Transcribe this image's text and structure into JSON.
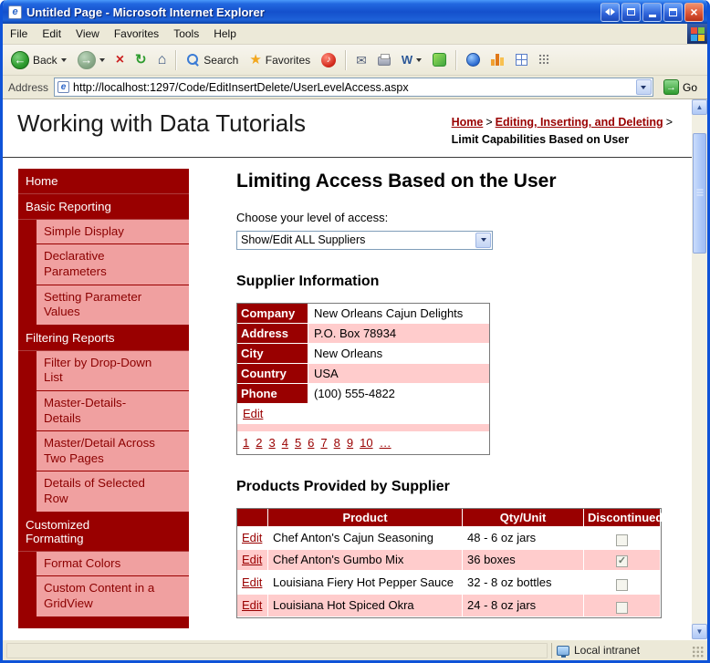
{
  "window": {
    "title": "Untitled Page - Microsoft Internet Explorer",
    "status_zone_label": "Local intranet"
  },
  "menu": {
    "items": [
      "File",
      "Edit",
      "View",
      "Favorites",
      "Tools",
      "Help"
    ]
  },
  "toolbar": {
    "back_label": "Back",
    "search_label": "Search",
    "favorites_label": "Favorites"
  },
  "address": {
    "label": "Address",
    "url": "http://localhost:1297/Code/EditInsertDelete/UserLevelAccess.aspx",
    "go_label": "Go"
  },
  "icons": {
    "ie_e": "e",
    "close": "×",
    "back_arrow": "←",
    "forward_arrow": "→",
    "stop": "×",
    "refresh": "↻",
    "home": "⌂",
    "favorites_star": "★",
    "media_note": "♪",
    "mail": "✉",
    "edit_w": "W",
    "go_arrow": "→",
    "arrow_up": "▲",
    "arrow_down": "▼"
  },
  "header": {
    "site_title": "Working with Data Tutorials",
    "breadcrumb": {
      "home": "Home",
      "separator": ">",
      "section": "Editing, Inserting, and Deleting",
      "current": "Limit Capabilities Based on User"
    }
  },
  "sidebar": {
    "items": [
      {
        "label": "Home",
        "type": "parent"
      },
      {
        "label": "Basic Reporting",
        "type": "parent"
      },
      {
        "label": "Simple Display",
        "type": "child"
      },
      {
        "label": "Declarative Parameters",
        "type": "child"
      },
      {
        "label": "Setting Parameter Values",
        "type": "child"
      },
      {
        "label": "Filtering Reports",
        "type": "parent"
      },
      {
        "label": "Filter by Drop-Down List",
        "type": "child"
      },
      {
        "label": "Master-Details-Details",
        "type": "child"
      },
      {
        "label": "Master/Detail Across Two Pages",
        "type": "child"
      },
      {
        "label": "Details of Selected Row",
        "type": "child"
      },
      {
        "label": "Customized Formatting",
        "type": "parent"
      },
      {
        "label": "Format Colors",
        "type": "child"
      },
      {
        "label": "Custom Content in a GridView",
        "type": "child"
      },
      {
        "label": "",
        "type": "parent-partial"
      }
    ]
  },
  "main": {
    "page_title": "Limiting Access Based on the User",
    "access_label": "Choose your level of access:",
    "access_value": "Show/Edit ALL Suppliers",
    "supplier_heading": "Supplier Information",
    "supplier": {
      "fields": [
        {
          "label": "Company",
          "value": "New Orleans Cajun Delights"
        },
        {
          "label": "Address",
          "value": "P.O. Box 78934"
        },
        {
          "label": "City",
          "value": "New Orleans"
        },
        {
          "label": "Country",
          "value": "USA"
        },
        {
          "label": "Phone",
          "value": "(100) 555-4822"
        }
      ],
      "edit_label": "Edit",
      "pager": [
        "1",
        "2",
        "3",
        "4",
        "5",
        "6",
        "7",
        "8",
        "9",
        "10",
        "…"
      ]
    },
    "products_heading": "Products Provided by Supplier",
    "grid": {
      "headers": [
        "Product",
        "Qty/Unit",
        "Discontinued"
      ],
      "rows": [
        {
          "edit": "Edit",
          "product": "Chef Anton's Cajun Seasoning",
          "qty": "48 - 6 oz jars",
          "discontinued": ""
        },
        {
          "edit": "Edit",
          "product": "Chef Anton's Gumbo Mix",
          "qty": "36 boxes",
          "discontinued": "✓"
        },
        {
          "edit": "Edit",
          "product": "Louisiana Fiery Hot Pepper Sauce",
          "qty": "32 - 8 oz bottles",
          "discontinued": ""
        },
        {
          "edit": "Edit",
          "product": "Louisiana Hot Spiced Okra",
          "qty": "24 - 8 oz jars",
          "discontinued": ""
        }
      ]
    }
  },
  "colors": {
    "maroon": "#990000",
    "alt_row_pink": "#FFCCCC",
    "nav_child_pink": "#F0A0A0",
    "link": "#990000",
    "titlebar_blue": "#1450CC"
  }
}
